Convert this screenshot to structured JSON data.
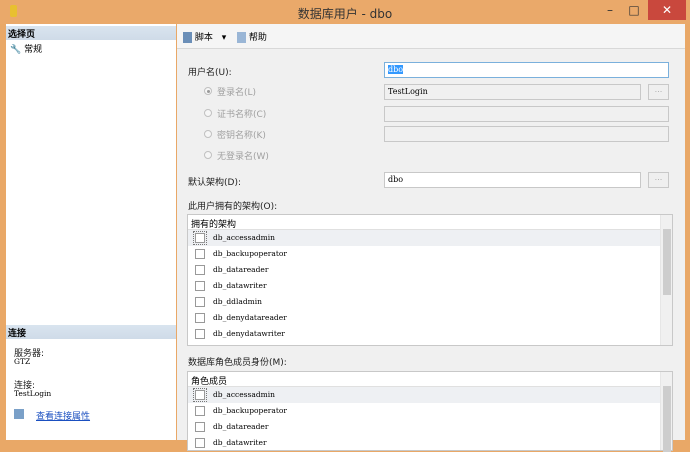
{
  "window": {
    "title": "数据库用户 - dbo",
    "minimize": "–",
    "maximize": "□",
    "close": "✕"
  },
  "left": {
    "select_page": "选择页",
    "pages": [
      {
        "label": "常规"
      }
    ],
    "connection_header": "连接",
    "server_label": "服务器:",
    "server_value": "GTZ",
    "connection_label": "连接:",
    "connection_value": "TestLogin",
    "view_link": "查看连接属性"
  },
  "toolbar": {
    "script": "脚本",
    "help": "帮助"
  },
  "form": {
    "username_label": "用户名(U):",
    "username_value": "dbo",
    "login_name_label": "登录名(L)",
    "login_name_value": "TestLogin",
    "cert_label": "证书名称(C)",
    "key_label": "密钥名称(K)",
    "no_login_label": "无登录名(W)",
    "default_schema_label": "默认架构(D):",
    "default_schema_value": "dbo",
    "browse": "...",
    "owned_label": "此用户拥有的架构(O):",
    "owned_header": "拥有的架构",
    "owned": [
      "db_accessadmin",
      "db_backupoperator",
      "db_datareader",
      "db_datawriter",
      "db_ddladmin",
      "db_denydatareader",
      "db_denydatawriter"
    ],
    "roles_label": "数据库角色成员身份(M):",
    "roles_header": "角色成员",
    "roles": [
      "db_accessadmin",
      "db_backupoperator",
      "db_datareader",
      "db_datawriter"
    ]
  }
}
